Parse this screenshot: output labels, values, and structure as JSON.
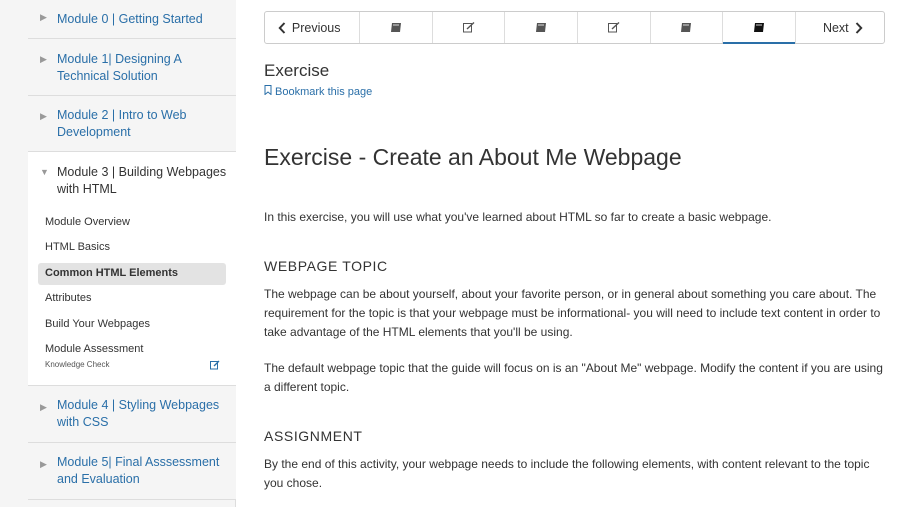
{
  "sidebar": {
    "modules": [
      {
        "label": "Module 0 | Getting Started"
      },
      {
        "label": "Module 1| Designing A Technical Solution"
      },
      {
        "label": "Module 2 | Intro to Web Development"
      },
      {
        "label": "Module 3 | Building Webpages with HTML"
      },
      {
        "label": "Module 4 | Styling Webpages with CSS"
      },
      {
        "label": "Module 5| Final Asssessment and Evaluation"
      }
    ],
    "submenu": [
      {
        "label": "Module Overview"
      },
      {
        "label": "HTML Basics"
      },
      {
        "label": "Common HTML Elements",
        "active": true
      },
      {
        "label": "Attributes"
      },
      {
        "label": "Build Your Webpages"
      },
      {
        "label": "Module Assessment",
        "sub": "Knowledge Check"
      }
    ]
  },
  "nav": {
    "previous_label": "Previous",
    "next_label": "Next",
    "items": [
      {
        "icon": "book-icon"
      },
      {
        "icon": "edit-icon"
      },
      {
        "icon": "book-icon"
      },
      {
        "icon": "edit-icon"
      },
      {
        "icon": "book-icon"
      },
      {
        "icon": "book-icon",
        "current": true
      }
    ]
  },
  "content": {
    "page_title": "Exercise",
    "bookmark_label": "Bookmark this page",
    "heading": "Exercise - Create an About Me Webpage",
    "intro": "In this exercise, you will use what you've learned about HTML so far to create a basic webpage.",
    "section1_title": "WEBPAGE TOPIC",
    "section1_p1": "The webpage can be about yourself, about your favorite person, or in general about something you care about. The requirement for the topic is that your webpage must be informational- you will need to include text content in order to take advantage of the HTML elements that you'll be using.",
    "section1_p2": "The default webpage topic that the guide will focus on is an \"About Me\" webpage. Modify the content if you are using a different topic.",
    "section2_title": "ASSIGNMENT",
    "section2_p1": "By the end of this activity, your webpage needs to include the following elements, with content relevant to the topic you chose."
  },
  "colors": {
    "link": "#2a6fa8",
    "sidebar_bg": "#f5f5f5",
    "active_bg": "#e3e3e3"
  }
}
